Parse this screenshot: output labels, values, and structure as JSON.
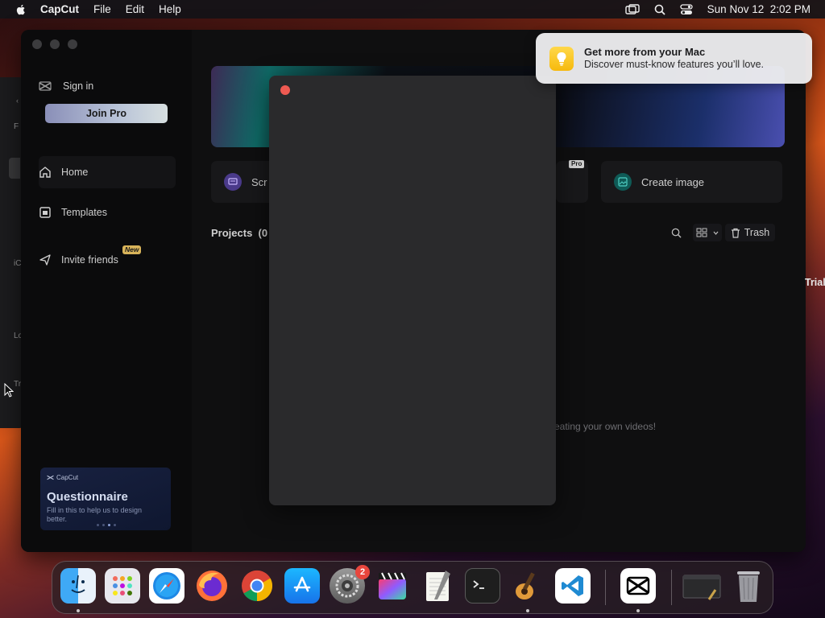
{
  "menubar": {
    "app_name": "CapCut",
    "items": [
      "File",
      "Edit",
      "Help"
    ],
    "datetime": "Sun Nov 12  2:02 PM"
  },
  "background_window": {
    "snippets": [
      "F",
      "iC",
      "Lo",
      "Tr"
    ]
  },
  "sidebar": {
    "sign_in": "Sign in",
    "join_pro": "Join Pro",
    "nav": [
      {
        "label": "Home",
        "icon": "home-icon"
      },
      {
        "label": "Templates",
        "icon": "templates-icon"
      },
      {
        "label": "Invite friends",
        "icon": "send-icon"
      }
    ],
    "new_badge": "New",
    "questionnaire": {
      "brand": "CapCut",
      "title": "Questionnaire",
      "desc": "Fill in this to help us to design better."
    }
  },
  "main": {
    "cards": [
      {
        "label": "Scr",
        "icon": "screen-record-icon",
        "color": "#6b4bd6"
      },
      {
        "label": "Create image",
        "icon": "image-icon",
        "color": "#1fb3a7"
      }
    ],
    "pro_badge": "Pro",
    "projects_label": "Projects  (0",
    "trash_label": "Trash",
    "empty_hint": "eating your own videos!"
  },
  "notification": {
    "title": "Get more from your Mac",
    "body": "Discover must-know features you’ll love.",
    "icon": "lightbulb-icon"
  },
  "desktop": {
    "trial_text": "Trial"
  },
  "dock": {
    "apps": [
      "Finder",
      "Launchpad",
      "Safari",
      "Firefox",
      "Chrome",
      "App Store",
      "System Settings",
      "Final Cut Pro",
      "TextEdit",
      "Terminal",
      "GarageBand",
      "Visual Studio Code",
      "CapCut",
      "Preview",
      "Trash"
    ],
    "settings_badge": "2"
  },
  "colors": {
    "accent_red": "#ee5a52",
    "join_pro_gradient_start": "#8a8fb8",
    "notification_bg": "#ececee"
  }
}
